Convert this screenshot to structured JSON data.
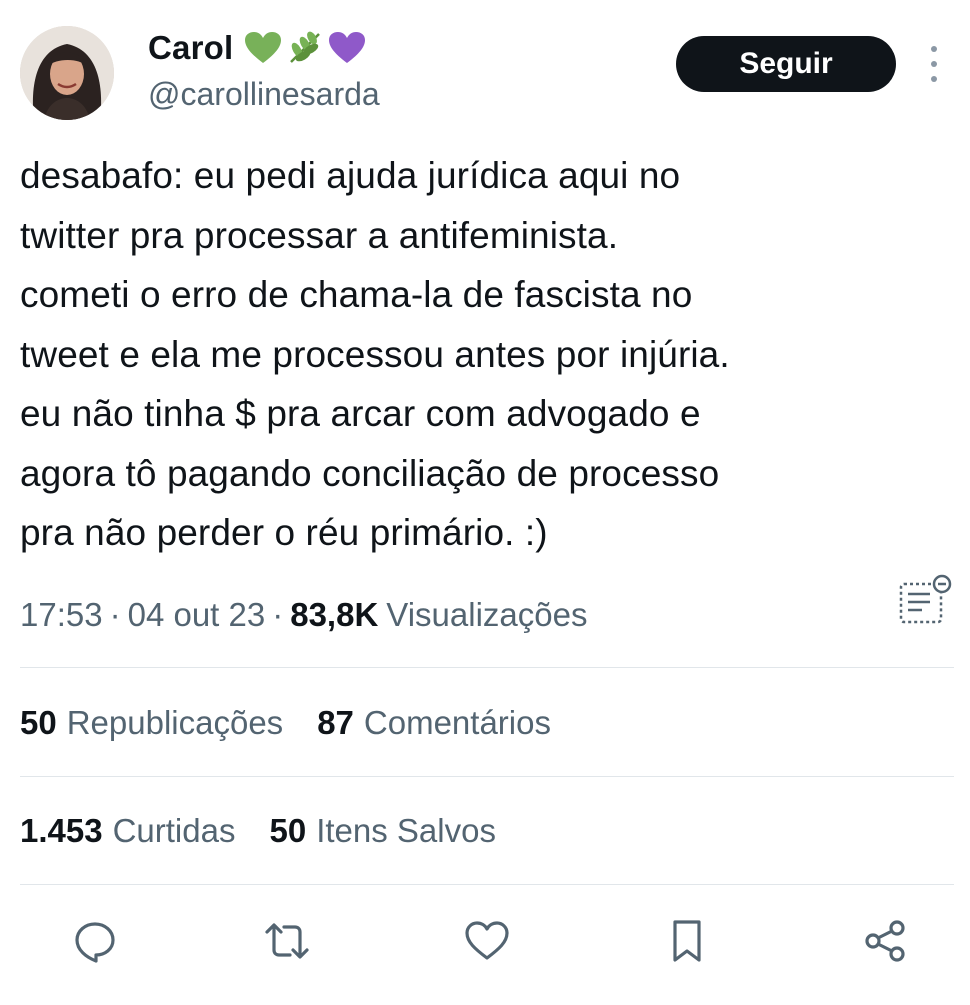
{
  "author": {
    "display_name": "Carol",
    "emojis": [
      "green-heart",
      "herb",
      "purple-heart"
    ],
    "handle": "@carollinesarda"
  },
  "follow_label": "Seguir",
  "tweet": {
    "text": "desabafo: eu pedi ajuda jurídica aqui no\ntwitter pra processar a antifeminista.\ncometi o erro de chama-la de fascista no\ntweet e ela me processou antes por injúria.\neu não tinha $ pra arcar com advogado e\nagora tô pagando conciliação de processo\npra não perder o réu primário. :)"
  },
  "meta": {
    "time": "17:53",
    "separator": "·",
    "date": "04 out 23",
    "views_count": "83,8K",
    "views_label": "Visualizações"
  },
  "stats": {
    "reposts": {
      "count": "50",
      "label": "Republicações"
    },
    "comments": {
      "count": "87",
      "label": "Comentários"
    },
    "likes": {
      "count": "1.453",
      "label": "Curtidas"
    },
    "bookmarks": {
      "count": "50",
      "label": "Itens Salvos"
    }
  },
  "icons": {
    "actions": [
      "reply-icon",
      "retweet-icon",
      "like-icon",
      "bookmark-icon",
      "share-icon"
    ]
  },
  "colors": {
    "text_primary": "#0f1419",
    "text_secondary": "#536471",
    "button_bg": "#0f1419",
    "divider": "#e1e6ea",
    "green_heart": "#78b159",
    "purple_heart": "#aa8ed6"
  }
}
